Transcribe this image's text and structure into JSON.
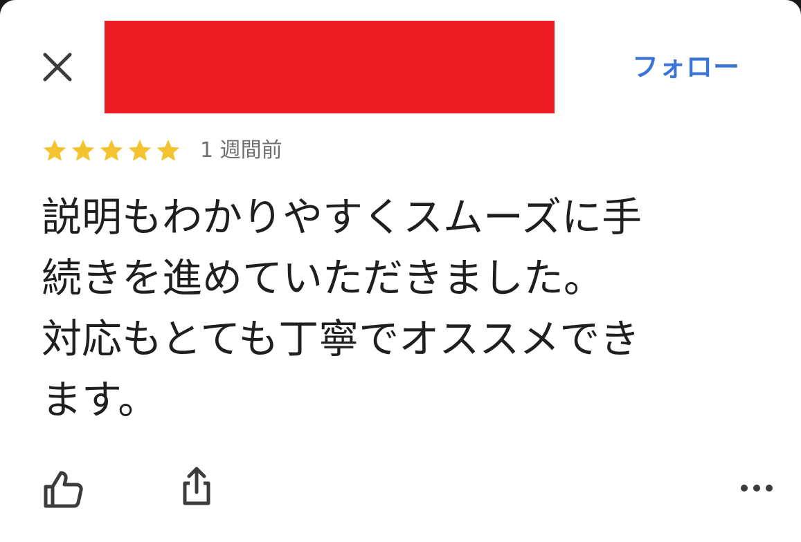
{
  "header": {
    "close_icon": "close-icon",
    "redacted_color": "#ed1c24",
    "follow_label": "フォロー",
    "accent_color": "#3b74d4"
  },
  "review": {
    "rating": 5,
    "rating_max": 5,
    "star_color": "#f4c430",
    "time_ago": "1 週間前",
    "text": "説明もわかりやすくスムーズに手\n続きを進めていただきました。\n対応もとても丁寧でオススメでき\nます。"
  },
  "actions": {
    "like_icon": "thumbs-up-icon",
    "share_icon": "share-icon",
    "more_icon": "more-horizontal-icon"
  }
}
